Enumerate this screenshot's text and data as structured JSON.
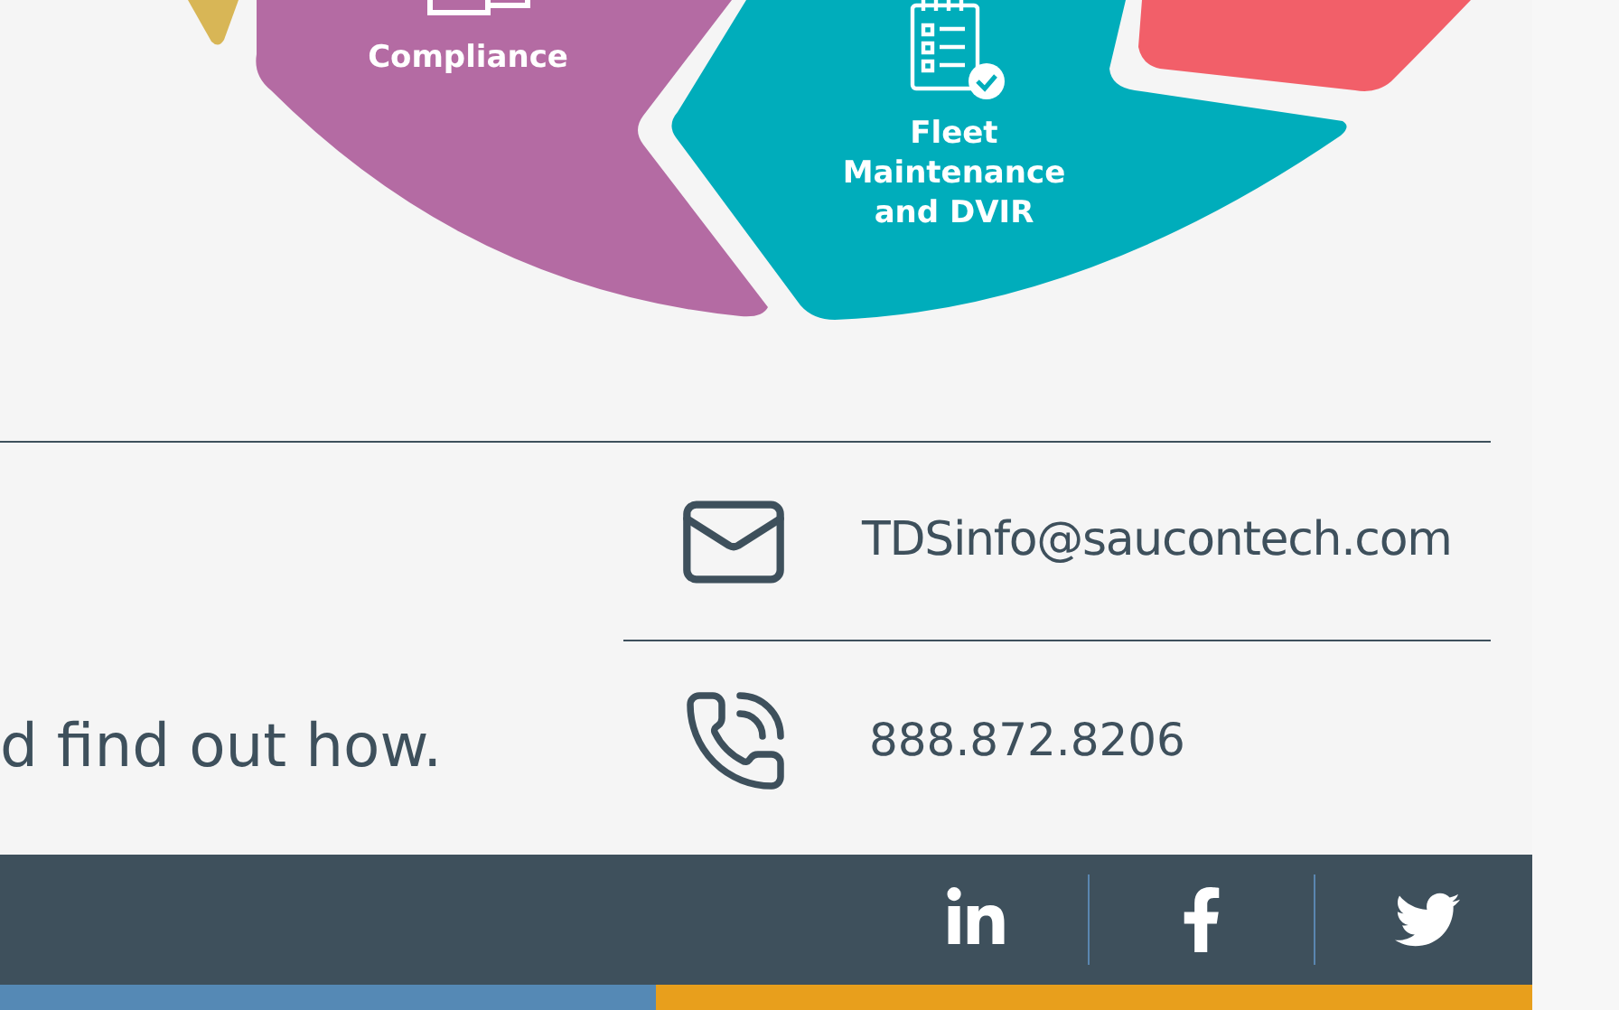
{
  "diagram": {
    "segments": [
      {
        "color": "#d8b656"
      },
      {
        "color": "#b46ba3",
        "label_lines": [
          "Compliance"
        ]
      },
      {
        "color": "#00adbb",
        "label_lines": [
          "Fleet",
          "Maintenance",
          "and DVIR"
        ]
      },
      {
        "color": "#f25f69"
      }
    ]
  },
  "tagline": "d find out how.",
  "contact": {
    "email": "TDSinfo@saucontech.com",
    "phone": "888.872.8206"
  },
  "footer": {
    "social": [
      {
        "kind": "linkedin"
      },
      {
        "kind": "facebook"
      },
      {
        "kind": "twitter"
      }
    ]
  }
}
